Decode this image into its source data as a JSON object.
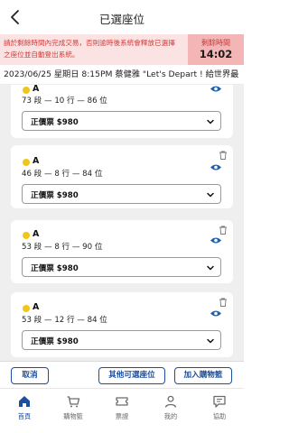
{
  "header": {
    "title": "已選座位"
  },
  "notice": {
    "message": "請於剩餘時間內完成交易，否則逾時後系統會釋放已選擇之座位並自動登出系統。",
    "timer_label": "剩餘時間",
    "timer_value": "14:02"
  },
  "event": {
    "info": "2023/06/25 星期日 8:15PM 蔡健雅 \"Let's Depart ! 給世界最"
  },
  "seats": [
    {
      "zone": "A",
      "seat": "73 段 — 10 行 — 86 位",
      "ticket": "正價票 $980"
    },
    {
      "zone": "A",
      "seat": "46 段 — 8 行 — 84 位",
      "ticket": "正價票 $980"
    },
    {
      "zone": "A",
      "seat": "53 段 — 8 行 — 90 位",
      "ticket": "正價票 $980"
    },
    {
      "zone": "A",
      "seat": "53 段 — 12 行 — 84 位",
      "ticket": "正價票 $980"
    }
  ],
  "actions": {
    "cancel": "取消",
    "other_seats": "其他可選座位",
    "add_cart": "加入購物籃"
  },
  "tabs": [
    {
      "label": "首頁"
    },
    {
      "label": "購物籃"
    },
    {
      "label": "票證"
    },
    {
      "label": "我的"
    },
    {
      "label": "協助"
    }
  ],
  "colors": {
    "accent": "#1e4f9c",
    "warning": "#d23a3a",
    "dot": "#f3c51a"
  }
}
